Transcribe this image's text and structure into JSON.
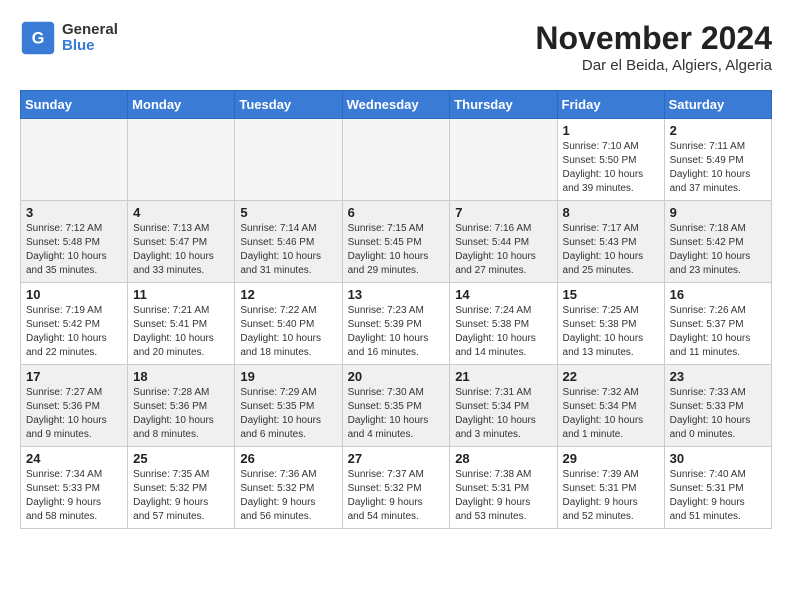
{
  "header": {
    "logo_general": "General",
    "logo_blue": "Blue",
    "month_title": "November 2024",
    "location": "Dar el Beida, Algiers, Algeria"
  },
  "weekdays": [
    "Sunday",
    "Monday",
    "Tuesday",
    "Wednesday",
    "Thursday",
    "Friday",
    "Saturday"
  ],
  "weeks": [
    {
      "row_style": "white",
      "days": [
        {
          "date": "",
          "info": "",
          "empty": true
        },
        {
          "date": "",
          "info": "",
          "empty": true
        },
        {
          "date": "",
          "info": "",
          "empty": true
        },
        {
          "date": "",
          "info": "",
          "empty": true
        },
        {
          "date": "",
          "info": "",
          "empty": true
        },
        {
          "date": "1",
          "info": "Sunrise: 7:10 AM\nSunset: 5:50 PM\nDaylight: 10 hours\nand 39 minutes."
        },
        {
          "date": "2",
          "info": "Sunrise: 7:11 AM\nSunset: 5:49 PM\nDaylight: 10 hours\nand 37 minutes."
        }
      ]
    },
    {
      "row_style": "gray",
      "days": [
        {
          "date": "3",
          "info": "Sunrise: 7:12 AM\nSunset: 5:48 PM\nDaylight: 10 hours\nand 35 minutes."
        },
        {
          "date": "4",
          "info": "Sunrise: 7:13 AM\nSunset: 5:47 PM\nDaylight: 10 hours\nand 33 minutes."
        },
        {
          "date": "5",
          "info": "Sunrise: 7:14 AM\nSunset: 5:46 PM\nDaylight: 10 hours\nand 31 minutes."
        },
        {
          "date": "6",
          "info": "Sunrise: 7:15 AM\nSunset: 5:45 PM\nDaylight: 10 hours\nand 29 minutes."
        },
        {
          "date": "7",
          "info": "Sunrise: 7:16 AM\nSunset: 5:44 PM\nDaylight: 10 hours\nand 27 minutes."
        },
        {
          "date": "8",
          "info": "Sunrise: 7:17 AM\nSunset: 5:43 PM\nDaylight: 10 hours\nand 25 minutes."
        },
        {
          "date": "9",
          "info": "Sunrise: 7:18 AM\nSunset: 5:42 PM\nDaylight: 10 hours\nand 23 minutes."
        }
      ]
    },
    {
      "row_style": "white",
      "days": [
        {
          "date": "10",
          "info": "Sunrise: 7:19 AM\nSunset: 5:42 PM\nDaylight: 10 hours\nand 22 minutes."
        },
        {
          "date": "11",
          "info": "Sunrise: 7:21 AM\nSunset: 5:41 PM\nDaylight: 10 hours\nand 20 minutes."
        },
        {
          "date": "12",
          "info": "Sunrise: 7:22 AM\nSunset: 5:40 PM\nDaylight: 10 hours\nand 18 minutes."
        },
        {
          "date": "13",
          "info": "Sunrise: 7:23 AM\nSunset: 5:39 PM\nDaylight: 10 hours\nand 16 minutes."
        },
        {
          "date": "14",
          "info": "Sunrise: 7:24 AM\nSunset: 5:38 PM\nDaylight: 10 hours\nand 14 minutes."
        },
        {
          "date": "15",
          "info": "Sunrise: 7:25 AM\nSunset: 5:38 PM\nDaylight: 10 hours\nand 13 minutes."
        },
        {
          "date": "16",
          "info": "Sunrise: 7:26 AM\nSunset: 5:37 PM\nDaylight: 10 hours\nand 11 minutes."
        }
      ]
    },
    {
      "row_style": "gray",
      "days": [
        {
          "date": "17",
          "info": "Sunrise: 7:27 AM\nSunset: 5:36 PM\nDaylight: 10 hours\nand 9 minutes."
        },
        {
          "date": "18",
          "info": "Sunrise: 7:28 AM\nSunset: 5:36 PM\nDaylight: 10 hours\nand 8 minutes."
        },
        {
          "date": "19",
          "info": "Sunrise: 7:29 AM\nSunset: 5:35 PM\nDaylight: 10 hours\nand 6 minutes."
        },
        {
          "date": "20",
          "info": "Sunrise: 7:30 AM\nSunset: 5:35 PM\nDaylight: 10 hours\nand 4 minutes."
        },
        {
          "date": "21",
          "info": "Sunrise: 7:31 AM\nSunset: 5:34 PM\nDaylight: 10 hours\nand 3 minutes."
        },
        {
          "date": "22",
          "info": "Sunrise: 7:32 AM\nSunset: 5:34 PM\nDaylight: 10 hours\nand 1 minute."
        },
        {
          "date": "23",
          "info": "Sunrise: 7:33 AM\nSunset: 5:33 PM\nDaylight: 10 hours\nand 0 minutes."
        }
      ]
    },
    {
      "row_style": "white",
      "days": [
        {
          "date": "24",
          "info": "Sunrise: 7:34 AM\nSunset: 5:33 PM\nDaylight: 9 hours\nand 58 minutes."
        },
        {
          "date": "25",
          "info": "Sunrise: 7:35 AM\nSunset: 5:32 PM\nDaylight: 9 hours\nand 57 minutes."
        },
        {
          "date": "26",
          "info": "Sunrise: 7:36 AM\nSunset: 5:32 PM\nDaylight: 9 hours\nand 56 minutes."
        },
        {
          "date": "27",
          "info": "Sunrise: 7:37 AM\nSunset: 5:32 PM\nDaylight: 9 hours\nand 54 minutes."
        },
        {
          "date": "28",
          "info": "Sunrise: 7:38 AM\nSunset: 5:31 PM\nDaylight: 9 hours\nand 53 minutes."
        },
        {
          "date": "29",
          "info": "Sunrise: 7:39 AM\nSunset: 5:31 PM\nDaylight: 9 hours\nand 52 minutes."
        },
        {
          "date": "30",
          "info": "Sunrise: 7:40 AM\nSunset: 5:31 PM\nDaylight: 9 hours\nand 51 minutes."
        }
      ]
    }
  ]
}
